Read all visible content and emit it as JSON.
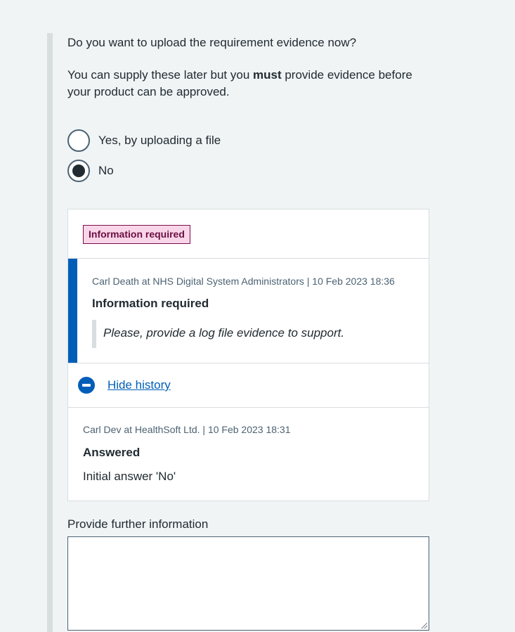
{
  "question": "Do you want to upload the requirement evidence now?",
  "hint": {
    "before": "You can supply these later but you ",
    "emphasis": "must",
    "after": " provide evidence before your product can be approved."
  },
  "radios": [
    {
      "label": "Yes, by uploading a file",
      "selected": false
    },
    {
      "label": "No",
      "selected": true
    }
  ],
  "status_tag": "Information required",
  "latest_entry": {
    "meta": "Carl Death at NHS Digital System Administrators | 10 Feb 2023 18:36",
    "title": "Information required",
    "comment": "Please, provide a log file evidence to support."
  },
  "history_toggle": "Hide history",
  "history_entry": {
    "meta": "Carl Dev at HealthSoft Ltd. | 10 Feb 2023 18:31",
    "title": "Answered",
    "body": "Initial answer 'No'"
  },
  "further_info": {
    "label": "Provide further information",
    "value": ""
  },
  "colors": {
    "accent": "#005eb8",
    "tag_bg": "#f9d5e9",
    "tag_text": "#6b0e40",
    "page_bg": "#f0f4f5"
  }
}
